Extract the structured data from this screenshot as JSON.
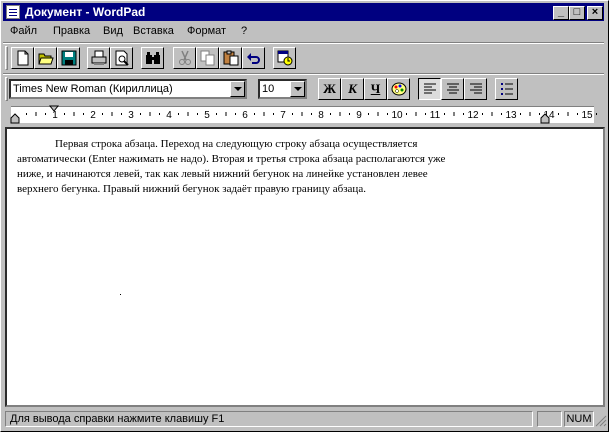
{
  "window": {
    "title": "Документ - WordPad"
  },
  "title_buttons": {
    "minimize": "_",
    "maximize": "□",
    "close": "×"
  },
  "menu": [
    {
      "label": "Файл"
    },
    {
      "label": "Правка"
    },
    {
      "label": "Вид"
    },
    {
      "label": "Вставка"
    },
    {
      "label": "Формат"
    },
    {
      "label": "?"
    }
  ],
  "toolbar": {
    "buttons": [
      "new-icon",
      "open-icon",
      "save-icon",
      "print-icon",
      "print-preview-icon",
      "find-icon",
      "cut-icon",
      "copy-icon",
      "paste-icon",
      "undo-icon",
      "insert-datetime-icon"
    ]
  },
  "format_bar": {
    "font": "Times New Roman (Кириллица)",
    "size": "10",
    "bold": "Ж",
    "italic": "К",
    "underline": "Ч",
    "color_icon": "color-palette-icon",
    "align": [
      "align-left-icon",
      "align-center-icon",
      "align-right-icon"
    ],
    "bullets_icon": "bullets-icon"
  },
  "ruler": {
    "numbers": [
      "1",
      "2",
      "3",
      "4",
      "5",
      "6",
      "7",
      "8",
      "9",
      "10",
      "11",
      "12",
      "13",
      "14",
      "15"
    ]
  },
  "document": {
    "lines": [
      "Первая строка абзаца. Переход на следующую строку абзаца осуществляется",
      "автоматически (Enter нажимать не надо). Вторая и третья строка абзаца располагаются уже",
      "ниже, и начинаются левей, так как левый нижний бегунок на линейке установлен левее",
      "верхнего бегунка. Правый нижний бегунок задаёт правую границу абзаца."
    ]
  },
  "statusbar": {
    "help": "Для вывода справки нажмите клавишу F1",
    "cap": "",
    "num": "NUM"
  }
}
